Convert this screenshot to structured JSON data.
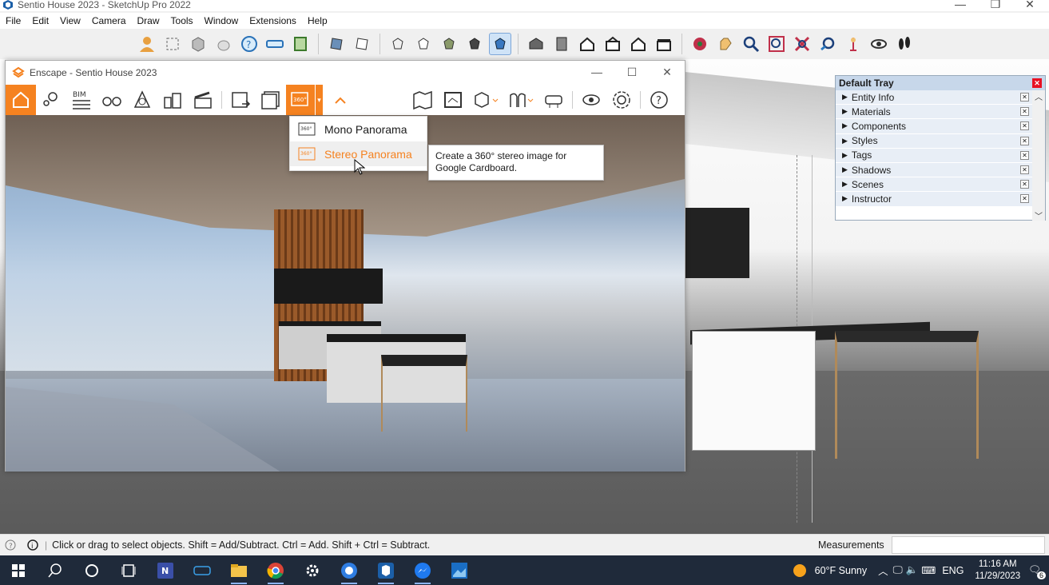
{
  "sketchup": {
    "title": "Sentio House 2023 - SketchUp Pro 2022",
    "menu": [
      "File",
      "Edit",
      "View",
      "Camera",
      "Draw",
      "Tools",
      "Window",
      "Extensions",
      "Help"
    ]
  },
  "enscape": {
    "title": "Enscape - Sentio House 2023",
    "toolbar_badge_bim": "BIM",
    "toolbar_badge_360": "360°",
    "pano_menu": {
      "items": [
        {
          "label": "Mono Panorama",
          "icon_badge": "360°"
        },
        {
          "label": "Stereo Panorama",
          "icon_badge": "360°"
        }
      ]
    },
    "tooltip": "Create a 360° stereo image for Google Cardboard."
  },
  "tray": {
    "title": "Default Tray",
    "panels": [
      "Entity Info",
      "Materials",
      "Components",
      "Styles",
      "Tags",
      "Shadows",
      "Scenes",
      "Instructor"
    ]
  },
  "status": {
    "message": "Click or drag to select objects. Shift = Add/Subtract. Ctrl = Add. Shift + Ctrl = Subtract.",
    "measurements_label": "Measurements",
    "measurements_value": ""
  },
  "taskbar": {
    "weather": "60°F  Sunny",
    "lang": "ENG",
    "time": "11:16 AM",
    "date": "11/29/2023",
    "notifications": "6",
    "colors": {
      "bg": "#1f2a3a",
      "accent": "#f58220"
    }
  }
}
